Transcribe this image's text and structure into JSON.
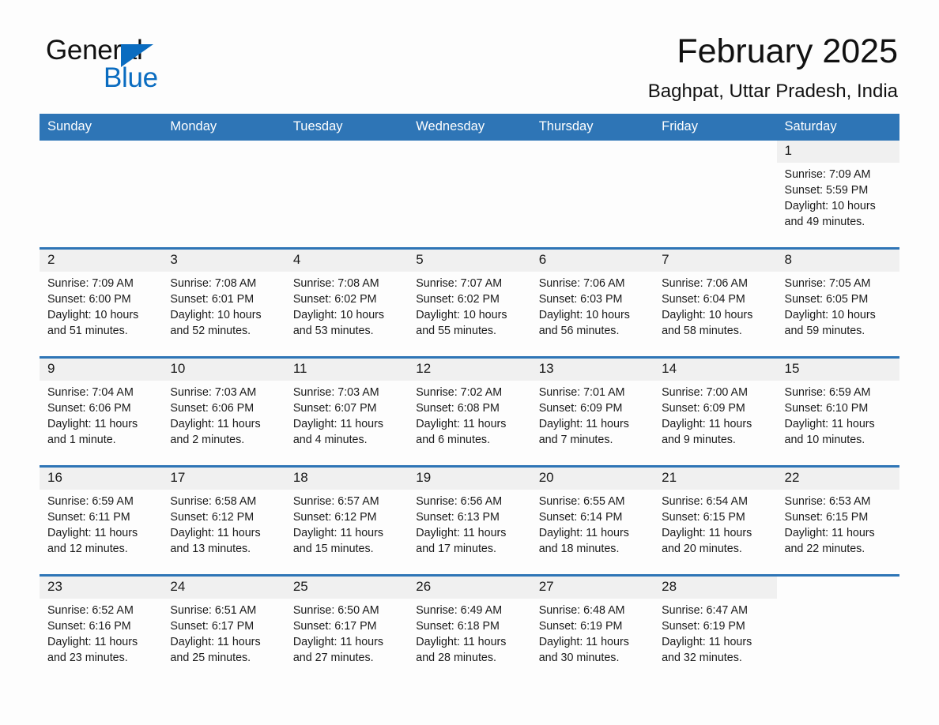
{
  "brand": {
    "name_part1": "General",
    "name_part2": "Blue",
    "triangle_color": "#0a6cc0"
  },
  "header": {
    "title": "February 2025",
    "subtitle": "Baghpat, Uttar Pradesh, India"
  },
  "theme": {
    "header_blue": "#2e75b6",
    "date_band": "#f0f0f0",
    "page_background": "#fdfdfd",
    "text": "#1a1a1a"
  },
  "calendar": {
    "weekday_headers": [
      "Sunday",
      "Monday",
      "Tuesday",
      "Wednesday",
      "Thursday",
      "Friday",
      "Saturday"
    ],
    "weeks": [
      [
        {
          "day": "",
          "sunrise": "",
          "sunset": "",
          "daylight": "",
          "blank": true
        },
        {
          "day": "",
          "sunrise": "",
          "sunset": "",
          "daylight": "",
          "blank": true
        },
        {
          "day": "",
          "sunrise": "",
          "sunset": "",
          "daylight": "",
          "blank": true
        },
        {
          "day": "",
          "sunrise": "",
          "sunset": "",
          "daylight": "",
          "blank": true
        },
        {
          "day": "",
          "sunrise": "",
          "sunset": "",
          "daylight": "",
          "blank": true
        },
        {
          "day": "",
          "sunrise": "",
          "sunset": "",
          "daylight": "",
          "blank": true
        },
        {
          "day": "1",
          "sunrise": "Sunrise: 7:09 AM",
          "sunset": "Sunset: 5:59 PM",
          "daylight": "Daylight: 10 hours and 49 minutes.",
          "blank": false
        }
      ],
      [
        {
          "day": "2",
          "sunrise": "Sunrise: 7:09 AM",
          "sunset": "Sunset: 6:00 PM",
          "daylight": "Daylight: 10 hours and 51 minutes.",
          "blank": false
        },
        {
          "day": "3",
          "sunrise": "Sunrise: 7:08 AM",
          "sunset": "Sunset: 6:01 PM",
          "daylight": "Daylight: 10 hours and 52 minutes.",
          "blank": false
        },
        {
          "day": "4",
          "sunrise": "Sunrise: 7:08 AM",
          "sunset": "Sunset: 6:02 PM",
          "daylight": "Daylight: 10 hours and 53 minutes.",
          "blank": false
        },
        {
          "day": "5",
          "sunrise": "Sunrise: 7:07 AM",
          "sunset": "Sunset: 6:02 PM",
          "daylight": "Daylight: 10 hours and 55 minutes.",
          "blank": false
        },
        {
          "day": "6",
          "sunrise": "Sunrise: 7:06 AM",
          "sunset": "Sunset: 6:03 PM",
          "daylight": "Daylight: 10 hours and 56 minutes.",
          "blank": false
        },
        {
          "day": "7",
          "sunrise": "Sunrise: 7:06 AM",
          "sunset": "Sunset: 6:04 PM",
          "daylight": "Daylight: 10 hours and 58 minutes.",
          "blank": false
        },
        {
          "day": "8",
          "sunrise": "Sunrise: 7:05 AM",
          "sunset": "Sunset: 6:05 PM",
          "daylight": "Daylight: 10 hours and 59 minutes.",
          "blank": false
        }
      ],
      [
        {
          "day": "9",
          "sunrise": "Sunrise: 7:04 AM",
          "sunset": "Sunset: 6:06 PM",
          "daylight": "Daylight: 11 hours and 1 minute.",
          "blank": false
        },
        {
          "day": "10",
          "sunrise": "Sunrise: 7:03 AM",
          "sunset": "Sunset: 6:06 PM",
          "daylight": "Daylight: 11 hours and 2 minutes.",
          "blank": false
        },
        {
          "day": "11",
          "sunrise": "Sunrise: 7:03 AM",
          "sunset": "Sunset: 6:07 PM",
          "daylight": "Daylight: 11 hours and 4 minutes.",
          "blank": false
        },
        {
          "day": "12",
          "sunrise": "Sunrise: 7:02 AM",
          "sunset": "Sunset: 6:08 PM",
          "daylight": "Daylight: 11 hours and 6 minutes.",
          "blank": false
        },
        {
          "day": "13",
          "sunrise": "Sunrise: 7:01 AM",
          "sunset": "Sunset: 6:09 PM",
          "daylight": "Daylight: 11 hours and 7 minutes.",
          "blank": false
        },
        {
          "day": "14",
          "sunrise": "Sunrise: 7:00 AM",
          "sunset": "Sunset: 6:09 PM",
          "daylight": "Daylight: 11 hours and 9 minutes.",
          "blank": false
        },
        {
          "day": "15",
          "sunrise": "Sunrise: 6:59 AM",
          "sunset": "Sunset: 6:10 PM",
          "daylight": "Daylight: 11 hours and 10 minutes.",
          "blank": false
        }
      ],
      [
        {
          "day": "16",
          "sunrise": "Sunrise: 6:59 AM",
          "sunset": "Sunset: 6:11 PM",
          "daylight": "Daylight: 11 hours and 12 minutes.",
          "blank": false
        },
        {
          "day": "17",
          "sunrise": "Sunrise: 6:58 AM",
          "sunset": "Sunset: 6:12 PM",
          "daylight": "Daylight: 11 hours and 13 minutes.",
          "blank": false
        },
        {
          "day": "18",
          "sunrise": "Sunrise: 6:57 AM",
          "sunset": "Sunset: 6:12 PM",
          "daylight": "Daylight: 11 hours and 15 minutes.",
          "blank": false
        },
        {
          "day": "19",
          "sunrise": "Sunrise: 6:56 AM",
          "sunset": "Sunset: 6:13 PM",
          "daylight": "Daylight: 11 hours and 17 minutes.",
          "blank": false
        },
        {
          "day": "20",
          "sunrise": "Sunrise: 6:55 AM",
          "sunset": "Sunset: 6:14 PM",
          "daylight": "Daylight: 11 hours and 18 minutes.",
          "blank": false
        },
        {
          "day": "21",
          "sunrise": "Sunrise: 6:54 AM",
          "sunset": "Sunset: 6:15 PM",
          "daylight": "Daylight: 11 hours and 20 minutes.",
          "blank": false
        },
        {
          "day": "22",
          "sunrise": "Sunrise: 6:53 AM",
          "sunset": "Sunset: 6:15 PM",
          "daylight": "Daylight: 11 hours and 22 minutes.",
          "blank": false
        }
      ],
      [
        {
          "day": "23",
          "sunrise": "Sunrise: 6:52 AM",
          "sunset": "Sunset: 6:16 PM",
          "daylight": "Daylight: 11 hours and 23 minutes.",
          "blank": false
        },
        {
          "day": "24",
          "sunrise": "Sunrise: 6:51 AM",
          "sunset": "Sunset: 6:17 PM",
          "daylight": "Daylight: 11 hours and 25 minutes.",
          "blank": false
        },
        {
          "day": "25",
          "sunrise": "Sunrise: 6:50 AM",
          "sunset": "Sunset: 6:17 PM",
          "daylight": "Daylight: 11 hours and 27 minutes.",
          "blank": false
        },
        {
          "day": "26",
          "sunrise": "Sunrise: 6:49 AM",
          "sunset": "Sunset: 6:18 PM",
          "daylight": "Daylight: 11 hours and 28 minutes.",
          "blank": false
        },
        {
          "day": "27",
          "sunrise": "Sunrise: 6:48 AM",
          "sunset": "Sunset: 6:19 PM",
          "daylight": "Daylight: 11 hours and 30 minutes.",
          "blank": false
        },
        {
          "day": "28",
          "sunrise": "Sunrise: 6:47 AM",
          "sunset": "Sunset: 6:19 PM",
          "daylight": "Daylight: 11 hours and 32 minutes.",
          "blank": false
        },
        {
          "day": "",
          "sunrise": "",
          "sunset": "",
          "daylight": "",
          "blank": true
        }
      ]
    ]
  }
}
